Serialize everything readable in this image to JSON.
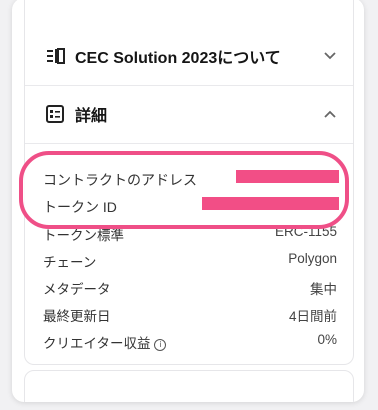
{
  "sections": {
    "about": {
      "title": "CEC Solution 2023について",
      "icon": "list-lines-icon",
      "expanded": false
    },
    "details": {
      "title": "詳細",
      "icon": "id-card-icon",
      "expanded": true
    }
  },
  "highlighted": {
    "contract_address_label": "コントラクトのアドレス",
    "token_id_label": "トークン ID"
  },
  "details_rows": [
    {
      "label": "トークン標準",
      "value": "ERC-1155"
    },
    {
      "label": "チェーン",
      "value": "Polygon"
    },
    {
      "label": "メタデータ",
      "value": "集中"
    },
    {
      "label": "最終更新日",
      "value": "4日間前"
    },
    {
      "label": "クリエイター収益",
      "value": "0%"
    }
  ],
  "colors": {
    "highlight": "#ef4f87",
    "redaction": "#f24e86"
  }
}
